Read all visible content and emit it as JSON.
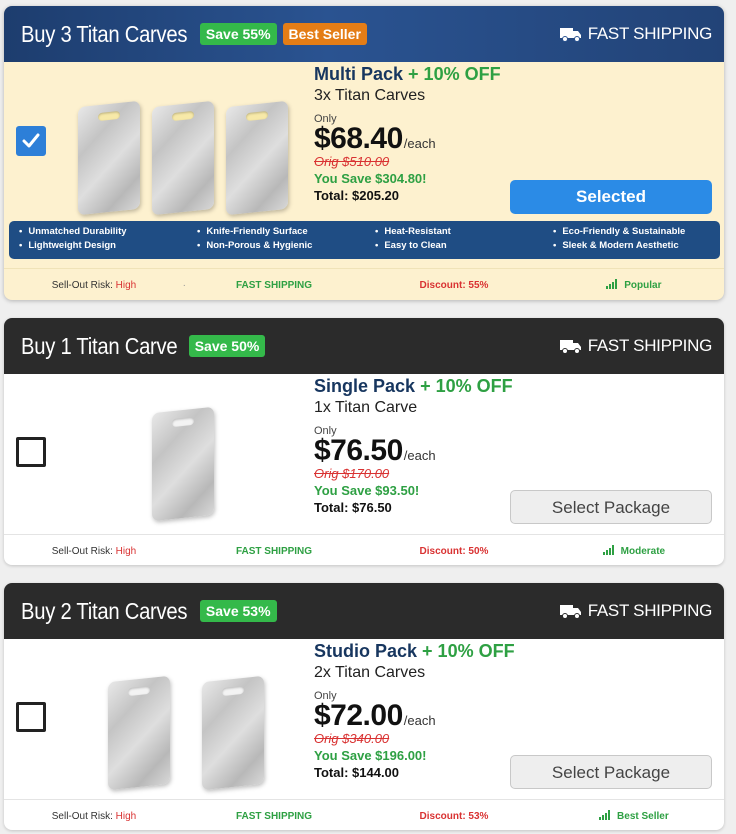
{
  "colors": {
    "selected_header": "#2a5391",
    "header_dark": "#2b2b2b",
    "save_badge": "#34b94a",
    "best_seller_badge": "#e47d16",
    "price_green": "#2ea043",
    "orig_red": "#d93232",
    "selected_button": "#2b8be6",
    "feature_bar": "#1f4d84"
  },
  "packages": [
    {
      "header_title": "Buy 3 Titan Carves",
      "save_badge": "Save 55%",
      "best_badge": "Best Seller",
      "shipping_label": "FAST SHIPPING",
      "pack_name": "Multi Pack",
      "pack_discount": "+ 10% OFF",
      "subtitle": "3x Titan Carves",
      "only_label": "Only",
      "price": "$68.40",
      "each_label": "/each",
      "orig": "Orig $510.00",
      "you_save": "You Save $304.80!",
      "total": "Total: $205.20",
      "button_label": "Selected",
      "selected": true,
      "board_count": 3,
      "features": [
        [
          "Unmatched Durability",
          "Lightweight Design"
        ],
        [
          "Knife-Friendly Surface",
          "Non-Porous & Hygienic"
        ],
        [
          "Heat-Resistant",
          "Easy to Clean"
        ],
        [
          "Eco-Friendly & Sustainable",
          "Sleek & Modern Aesthetic"
        ]
      ],
      "status": {
        "risk_label": "Sell-Out Risk:",
        "risk_value": "High",
        "shipping": "FAST SHIPPING",
        "discount": "Discount: 55%",
        "popularity": "Popular"
      }
    },
    {
      "header_title": "Buy 1 Titan Carve",
      "save_badge": "Save 50%",
      "shipping_label": "FAST SHIPPING",
      "pack_name": "Single Pack",
      "pack_discount": "+ 10% OFF",
      "subtitle": "1x Titan Carve",
      "only_label": "Only",
      "price": "$76.50",
      "each_label": "/each",
      "orig": "Orig $170.00",
      "you_save": "You Save $93.50!",
      "total": "Total: $76.50",
      "button_label": "Select Package",
      "selected": false,
      "board_count": 1,
      "status": {
        "risk_label": "Sell-Out Risk:",
        "risk_value": "High",
        "shipping": "FAST SHIPPING",
        "discount": "Discount: 50%",
        "popularity": "Moderate"
      }
    },
    {
      "header_title": "Buy 2 Titan Carves",
      "save_badge": "Save 53%",
      "shipping_label": "FAST SHIPPING",
      "pack_name": "Studio Pack",
      "pack_discount": "+ 10% OFF",
      "subtitle": "2x Titan Carves",
      "only_label": "Only",
      "price": "$72.00",
      "each_label": "/each",
      "orig": "Orig $340.00",
      "you_save": "You Save $196.00!",
      "total": "Total: $144.00",
      "button_label": "Select Package",
      "selected": false,
      "board_count": 2,
      "status": {
        "risk_label": "Sell-Out Risk:",
        "risk_value": "High",
        "shipping": "FAST SHIPPING",
        "discount": "Discount: 53%",
        "popularity": "Best Seller"
      }
    }
  ]
}
